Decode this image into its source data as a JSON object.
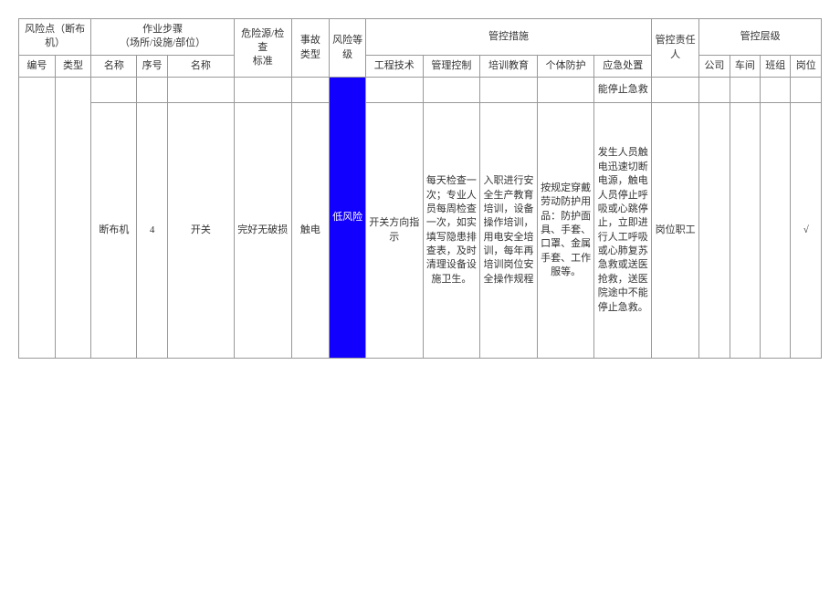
{
  "headers": {
    "risk_point": "风险点（断布机）",
    "work_step": "作业步骤\n（场所/设施/部位）",
    "hazard_std": "危险源/检查\n标准",
    "accident_type": "事故\n类型",
    "risk_level": "风险等\n级",
    "control_measures": "管控措施",
    "responsible": "管控责任人",
    "control_level": "管控层级",
    "sub": {
      "bianhao": "编号",
      "leixing": "类型",
      "mingcheng": "名称",
      "xuhao": "序号",
      "mingcheng2": "名称",
      "gongcheng": "工程技术",
      "guanli": "管理控制",
      "peixun": "培训教育",
      "geti": "个体防护",
      "yingji": "应急处置",
      "gongsi": "公司",
      "chejian": "车间",
      "banzu": "班组",
      "gangwei": "岗位"
    }
  },
  "row0": {
    "yingji": "能停止急救"
  },
  "row1": {
    "mingcheng": "断布机",
    "xuhao": "4",
    "mingcheng2": "开关",
    "weixian": "完好无破损",
    "shigu": "触电",
    "fengxian": "低风险",
    "gongcheng": "开关方向指示",
    "guanli": "每天检查一次；专业人员每周检查一次，如实填写隐患排查表，及时清理设备设施卫生。",
    "peixun": "入职进行安全生产教育培训，设备操作培训，用电安全培训，每年再培训岗位安全操作规程",
    "geti": "按规定穿戴劳动防护用品：防护面具、手套、口罩、金属手套、工作服等。",
    "yingji": "发生人员触电迅速切断电源，触电人员停止呼吸或心跳停止，立即进行人工呼吸或心肺复苏急救或送医抢救，送医院途中不能停止急救。",
    "zeren": "岗位职工",
    "gangwei_mark": "√"
  }
}
